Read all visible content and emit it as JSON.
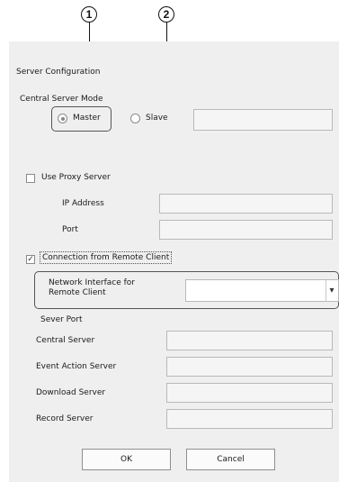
{
  "callouts": [
    "1",
    "2"
  ],
  "dialog": {
    "section_title": "Server Configuration",
    "central_mode": {
      "label": "Central Server Mode",
      "options": [
        {
          "label": "Master",
          "selected": true
        },
        {
          "label": "Slave",
          "selected": false
        }
      ],
      "slave_address_value": ""
    },
    "proxy": {
      "checkbox_label": "Use Proxy Server",
      "checked": false,
      "ip_label": "IP Address",
      "ip_value": "",
      "port_label": "Port",
      "port_value": ""
    },
    "remote": {
      "checkbox_label": "Connection from Remote Client",
      "checked": true,
      "checkmark": "✓",
      "interface_label_line1": "Network Interface for",
      "interface_label_line2": "Remote Client",
      "interface_value": "",
      "dropdown_arrow": "▾"
    },
    "server_port": {
      "heading": "Sever Port",
      "rows": [
        {
          "label": "Central Server",
          "value": ""
        },
        {
          "label": "Event Action Server",
          "value": ""
        },
        {
          "label": "Download Server",
          "value": ""
        },
        {
          "label": "Record Server",
          "value": ""
        }
      ]
    },
    "buttons": {
      "ok": "OK",
      "cancel": "Cancel"
    }
  }
}
